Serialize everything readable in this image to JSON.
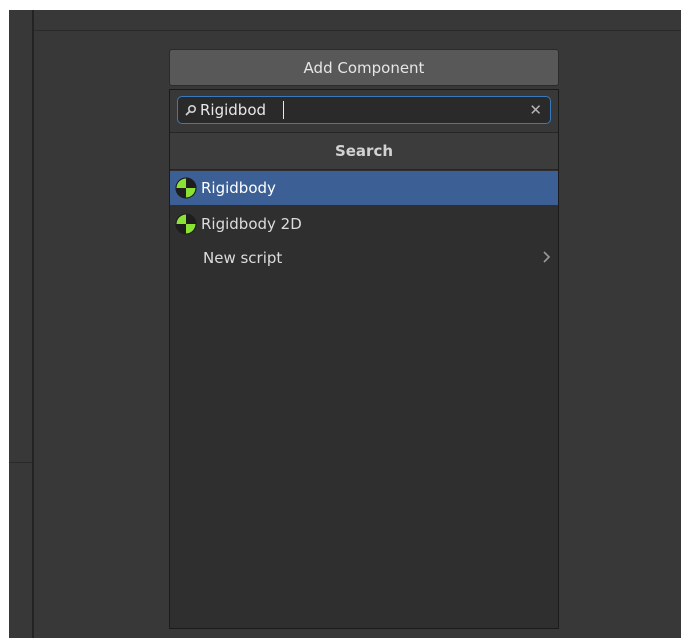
{
  "button": {
    "label": "Add Component"
  },
  "search": {
    "value": "Rigidbod",
    "placeholder": ""
  },
  "header": {
    "title": "Search"
  },
  "results": [
    {
      "label": "Rigidbody",
      "icon": "rigidbody-icon",
      "selected": true
    },
    {
      "label": "Rigidbody 2D",
      "icon": "rigidbody2d-icon",
      "selected": false
    },
    {
      "label": "New script",
      "icon": "chevron-right-icon",
      "selected": false
    }
  ],
  "colors": {
    "background": "#383838",
    "popup": "#2f2f2f",
    "selection": "#3c5f95",
    "search_focus_border": "#3a79bb",
    "icon_green": "#8ae234"
  }
}
